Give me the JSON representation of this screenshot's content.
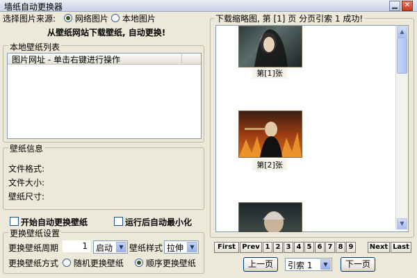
{
  "window": {
    "title": "墙纸自动更换器"
  },
  "source": {
    "label": "选择图片来源:",
    "options": [
      {
        "label": "网络图片",
        "selected": true
      },
      {
        "label": "本地图片",
        "selected": false
      }
    ],
    "message": "从壁纸网站下载壁纸, 自动更换!"
  },
  "local_list": {
    "group_label": "本地壁纸列表",
    "column_header": "图片网址 - 单击右键进行操作"
  },
  "info": {
    "group_label": "壁纸信息",
    "format_label": "文件格式:",
    "size_label": "文件大小:",
    "dims_label": "壁纸尺寸:"
  },
  "checks": {
    "auto_change": "开始自动更换壁纸",
    "minimize": "运行后自动最小化"
  },
  "settings": {
    "group_label": "更换壁纸设置",
    "period_label": "更换壁纸周期",
    "period_value": "1",
    "start_value": "启动",
    "style_label": "壁纸样式",
    "style_value": "拉伸",
    "mode_label": "更换壁纸方式",
    "mode_options": [
      {
        "label": "随机更换壁纸",
        "selected": false
      },
      {
        "label": "顺序更换壁纸",
        "selected": true
      }
    ]
  },
  "thumbs": {
    "status": "下载缩略图, 第 [1] 页 分页引索 1  成功!",
    "captions": [
      "第[1]张",
      "第[2]张"
    ]
  },
  "pager": {
    "first": "First",
    "prev": "Prev",
    "next": "Next",
    "last": "Last",
    "pages": [
      "1",
      "2",
      "3",
      "4",
      "5",
      "6",
      "7",
      "8",
      "9"
    ],
    "prev_page": "上一页",
    "next_page": "下一页",
    "index_value": "引索 1"
  }
}
